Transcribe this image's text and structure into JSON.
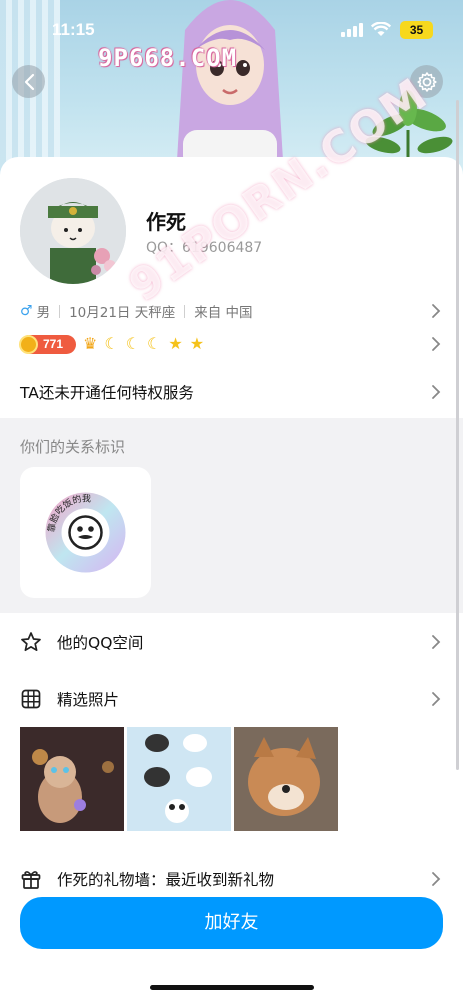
{
  "status_bar": {
    "time": "11:15",
    "battery": "35"
  },
  "watermark": {
    "top": "9P668.COM",
    "diagonal": "91PORN.COM"
  },
  "header": {
    "back_icon": "chevron-left-icon",
    "settings_icon": "gear-icon"
  },
  "profile": {
    "name": "作死",
    "qq": "QQ：619606487",
    "gender": "男",
    "birthday": "10月21日 天秤座",
    "location": "来自 中国",
    "level": "771",
    "level_icons": [
      "crown",
      "moon",
      "moon",
      "moon",
      "star",
      "star"
    ]
  },
  "privilege": {
    "label": "TA还未开通任何特权服务"
  },
  "relation": {
    "title": "你们的关系标识",
    "medal_text": "靠脸吃饭的我"
  },
  "menu": {
    "qzone": "他的QQ空间",
    "photos": "精选照片",
    "gifts": "作死的礼物墙：最近收到新礼物"
  },
  "add_friend": {
    "label": "加好友"
  },
  "colors": {
    "accent": "#0099ff",
    "level_badge": "#ef5b3f"
  }
}
